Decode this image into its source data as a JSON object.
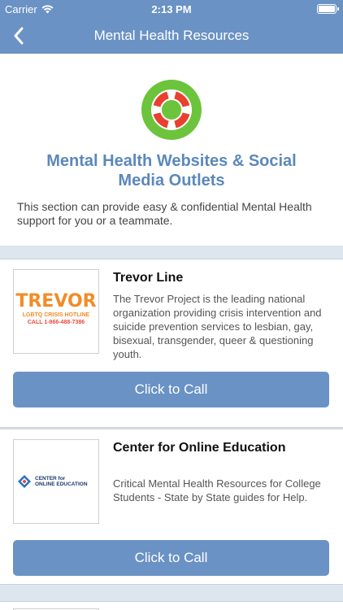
{
  "status": {
    "carrier": "Carrier",
    "time": "2:13 PM"
  },
  "nav": {
    "title": "Mental Health Resources"
  },
  "header": {
    "title": "Mental Health Websites & Social Media Outlets",
    "description": "This section can provide easy & confidential Mental Health support for you or a teammate."
  },
  "resources": [
    {
      "title": "Trevor Line",
      "description": "The Trevor Project is the leading national organization providing crisis intervention and suicide prevention services to lesbian, gay, bisexual, transgender, queer & questioning youth.",
      "button": "Click to Call",
      "logo": {
        "word": "TREVOR",
        "line2": "LGBTQ CRISIS HOTLINE",
        "line3": "CALL 1-866-488-7386"
      }
    },
    {
      "title": "Center for Online Education",
      "description": "Critical Mental Health Resources for College Students - State by State guides for Help.",
      "button": "Click to Call",
      "logo": {
        "line1": "CENTER for",
        "line2": "ONLINE EDUCATION"
      }
    }
  ],
  "colors": {
    "accent": "#6a92c4",
    "title_blue": "#5b88bb",
    "lifebuoy_green": "#6cc43c",
    "lifebuoy_red": "#e8412f",
    "trevor_orange": "#f28c28"
  }
}
